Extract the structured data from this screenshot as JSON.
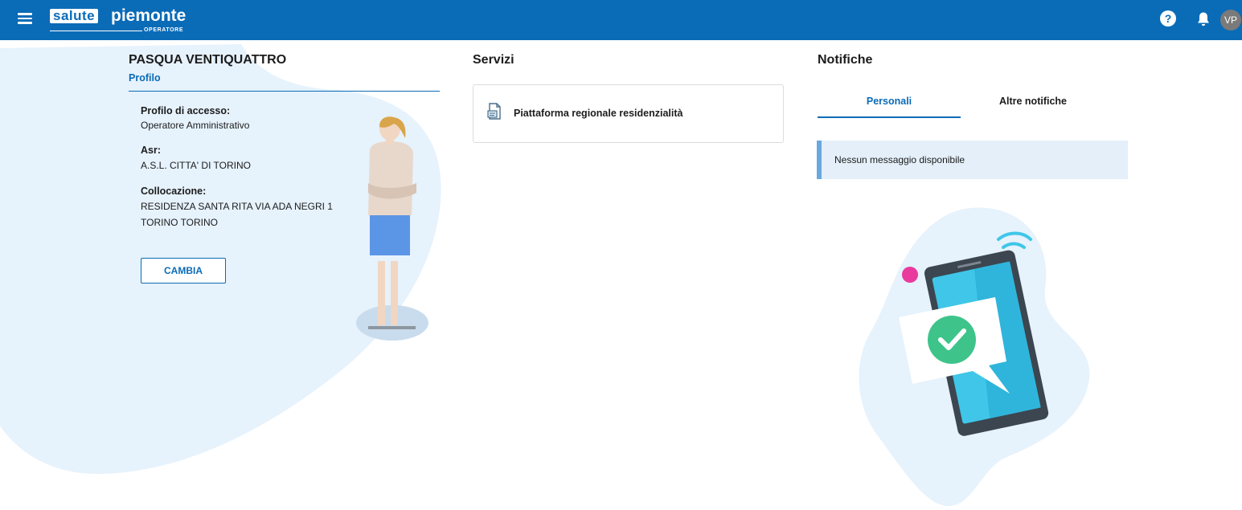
{
  "header": {
    "logo_main": "salute",
    "logo_region": "piemonte",
    "logo_sub": "OPERATORE",
    "help_glyph": "?",
    "avatar_initials": "VP",
    "icons": [
      "menu-icon",
      "help-icon",
      "bell-icon"
    ]
  },
  "profile": {
    "name": "PASQUA VENTIQUATTRO",
    "tab_label": "Profilo",
    "access_label": "Profilo di accesso:",
    "access_value": "Operatore Amministrativo",
    "asr_label": "Asr:",
    "asr_value": "A.S.L. CITTA' DI TORINO",
    "location_label": "Collocazione:",
    "location_value_line1": "RESIDENZA SANTA RITA VIA ADA NEGRI 1",
    "location_value_line2": "TORINO TORINO",
    "change_button": "CAMBIA"
  },
  "services": {
    "title": "Servizi",
    "items": [
      {
        "label": "Piattaforma regionale residenzialità",
        "icon": "document-icon"
      }
    ]
  },
  "notifications": {
    "title": "Notifiche",
    "tabs": [
      {
        "label": "Personali",
        "active": true
      },
      {
        "label": "Altre notifiche",
        "active": false
      }
    ],
    "empty_message": "Nessun messaggio disponibile"
  },
  "colors": {
    "brand": "#0a6bb7",
    "background_blob": "#e6f2fc",
    "empty_box": "#e4eff9",
    "empty_box_accent": "#6aa8e0",
    "check_green": "#3ec48a"
  }
}
